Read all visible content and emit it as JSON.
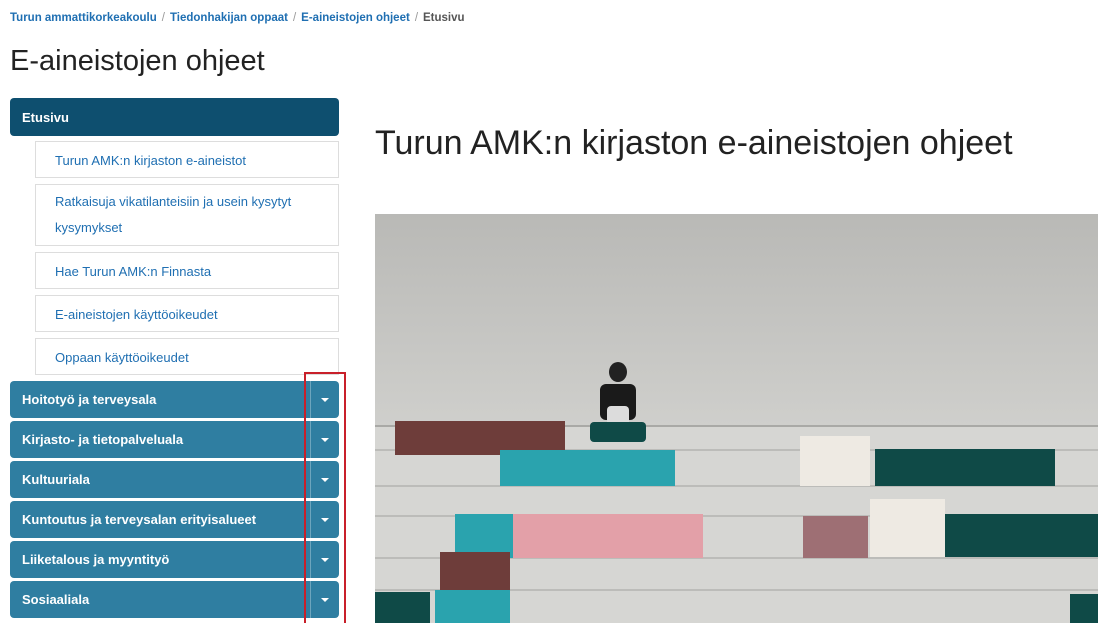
{
  "breadcrumb": {
    "items": [
      "Turun ammattikorkeakoulu",
      "Tiedonhakijan oppaat",
      "E-aineistojen ohjeet"
    ],
    "separator": "/",
    "current": "Etusivu"
  },
  "page": {
    "title": "E-aineistojen ohjeet"
  },
  "sidebar": {
    "home": "Etusivu",
    "sub_items": [
      "Turun AMK:n kirjaston e-aineistot",
      "Ratkaisuja vikatilanteisiin ja usein kysytyt kysymykset",
      "Hae Turun AMK:n Finnasta",
      "E-aineistojen käyttöoikeudet",
      "Oppaan käyttöoikeudet"
    ],
    "sections": [
      "Hoitotyö ja terveysala",
      "Kirjasto- ja tietopalveluala",
      "Kultuuriala",
      "Kuntoutus ja terveysalan erityisalueet",
      "Liiketalous ja myyntityö",
      "Sosiaaliala"
    ]
  },
  "main": {
    "heading": "Turun AMK:n kirjaston e-aineistojen ohjeet"
  },
  "colors": {
    "home_bg": "#0e4f6f",
    "section_bg": "#2f7ea1",
    "link": "#1f6fb2",
    "highlight": "#c8202a"
  }
}
